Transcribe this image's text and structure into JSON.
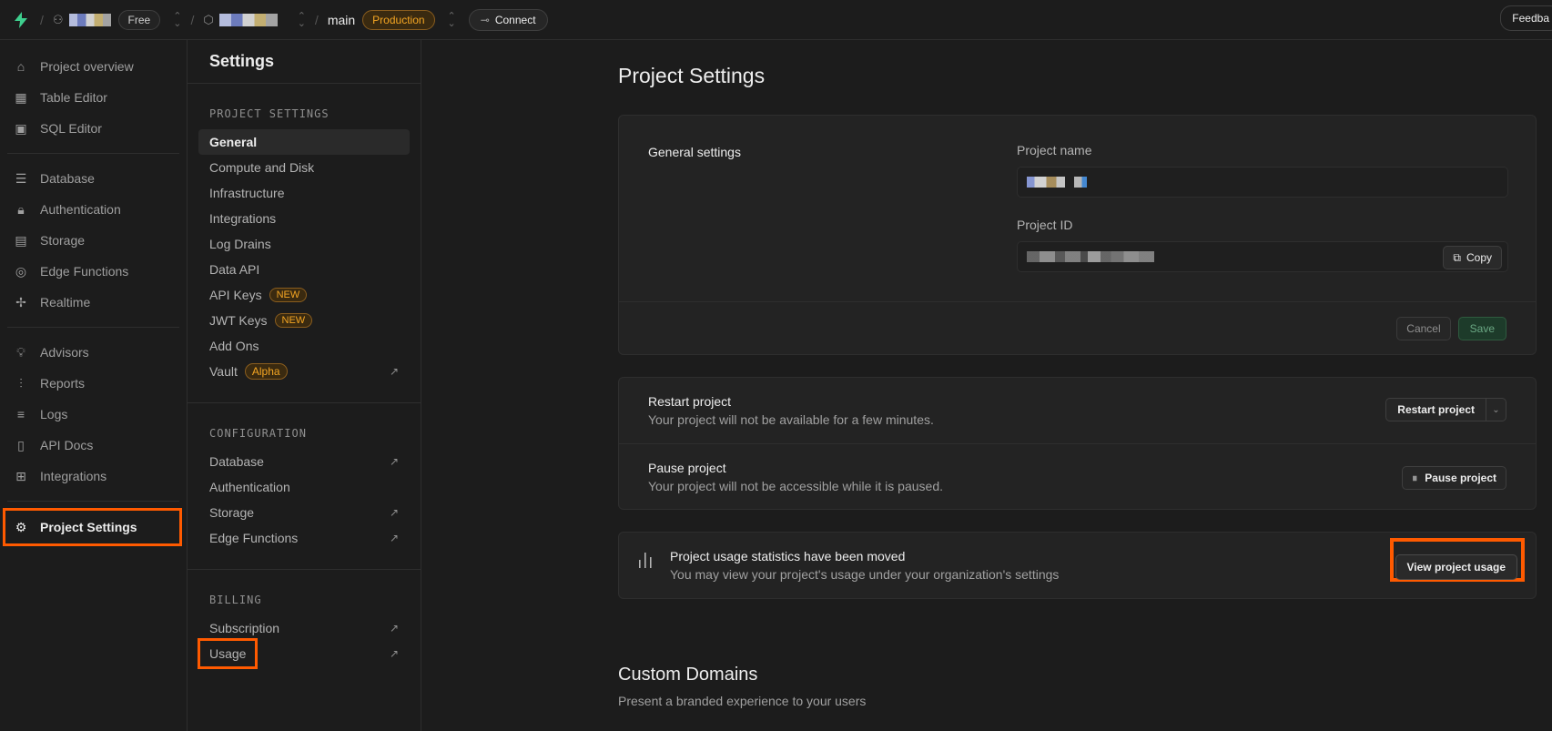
{
  "topbar": {
    "org_plan": "Free",
    "branch": "main",
    "env": "Production",
    "connect": "Connect",
    "feedback": "Feedba"
  },
  "leftnav": {
    "items": [
      {
        "label": "Project overview",
        "icon": "home-icon"
      },
      {
        "label": "Table Editor",
        "icon": "table-icon"
      },
      {
        "label": "SQL Editor",
        "icon": "terminal-icon"
      },
      {
        "label": "Database",
        "icon": "database-icon"
      },
      {
        "label": "Authentication",
        "icon": "lock-icon"
      },
      {
        "label": "Storage",
        "icon": "archive-icon"
      },
      {
        "label": "Edge Functions",
        "icon": "edge-functions-icon"
      },
      {
        "label": "Realtime",
        "icon": "realtime-icon"
      },
      {
        "label": "Advisors",
        "icon": "lightbulb-icon"
      },
      {
        "label": "Reports",
        "icon": "chart-icon"
      },
      {
        "label": "Logs",
        "icon": "list-icon"
      },
      {
        "label": "API Docs",
        "icon": "file-icon"
      },
      {
        "label": "Integrations",
        "icon": "blocks-icon"
      },
      {
        "label": "Project Settings",
        "icon": "gear-icon"
      }
    ]
  },
  "settings_sidebar": {
    "title": "Settings",
    "project_heading": "PROJECT SETTINGS",
    "project_items": [
      "General",
      "Compute and Disk",
      "Infrastructure",
      "Integrations",
      "Log Drains",
      "Data API",
      "API Keys",
      "JWT Keys",
      "Add Ons",
      "Vault"
    ],
    "badge_new": "NEW",
    "badge_alpha": "Alpha",
    "config_heading": "CONFIGURATION",
    "config_items": [
      "Database",
      "Authentication",
      "Storage",
      "Edge Functions"
    ],
    "billing_heading": "BILLING",
    "billing_items": [
      "Subscription",
      "Usage"
    ]
  },
  "main": {
    "title": "Project Settings",
    "general": {
      "label": "General settings",
      "project_name_label": "Project name",
      "project_id_label": "Project ID",
      "copy": "Copy",
      "cancel": "Cancel",
      "save": "Save"
    },
    "restart": {
      "title": "Restart project",
      "desc": "Your project will not be available for a few minutes.",
      "button": "Restart project"
    },
    "pause": {
      "title": "Pause project",
      "desc": "Your project will not be accessible while it is paused.",
      "button": "Pause project"
    },
    "usage": {
      "title": "Project usage statistics have been moved",
      "desc": "You may view your project's usage under your organization's settings",
      "button": "View project usage"
    },
    "custom_domains": {
      "title": "Custom Domains",
      "desc": "Present a branded experience to your users"
    }
  },
  "colors": {
    "accent_highlight": "#ff5a00",
    "brand": "#3ecf8e",
    "production_badge": "#f5a623"
  }
}
